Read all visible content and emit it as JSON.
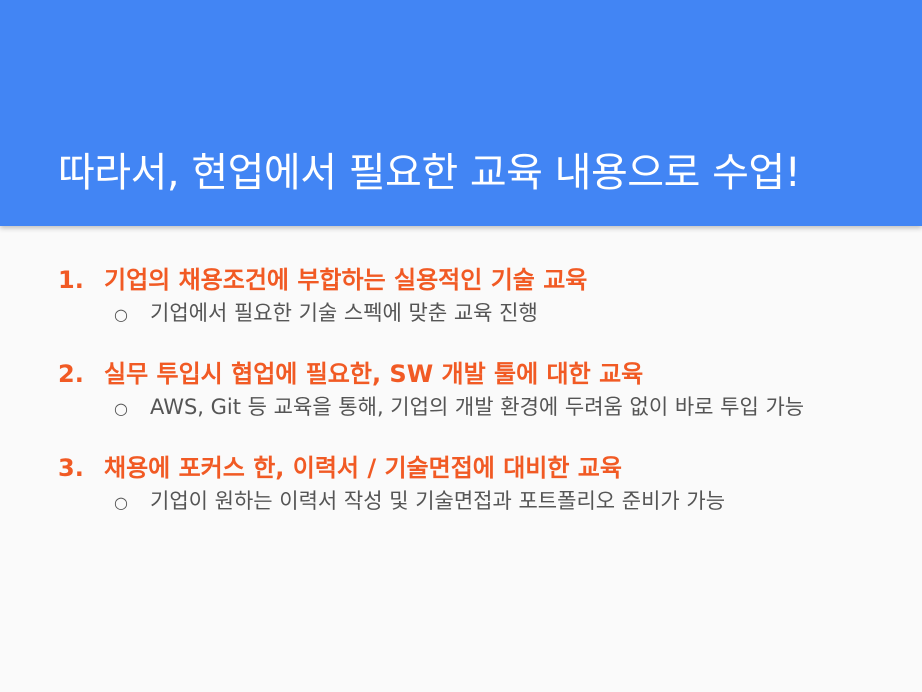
{
  "slide": {
    "title": "따라서, 현업에서 필요한 교육 내용으로 수업!",
    "items": [
      {
        "number": "1.",
        "heading": "기업의 채용조건에 부합하는 실용적인 기술 교육",
        "bullet": "○",
        "detail": "기업에서 필요한 기술 스펙에 맞춘 교육 진행"
      },
      {
        "number": "2.",
        "heading": "실무 투입시 협업에 필요한, SW 개발 툴에 대한 교육",
        "bullet": "○",
        "detail": "AWS, Git 등 교육을 통해, 기업의 개발 환경에 두려움 없이 바로 투입 가능"
      },
      {
        "number": "3.",
        "heading": "채용에 포커스 한, 이력서 / 기술면접에 대비한 교육",
        "bullet": "○",
        "detail": "기업이 원하는 이력서 작성 및 기술면접과 포트폴리오 준비가 가능"
      }
    ]
  },
  "colors": {
    "header_background": "#4285f4",
    "heading_text": "#f15a24",
    "body_text": "#555555",
    "slide_background": "#fafafa"
  }
}
